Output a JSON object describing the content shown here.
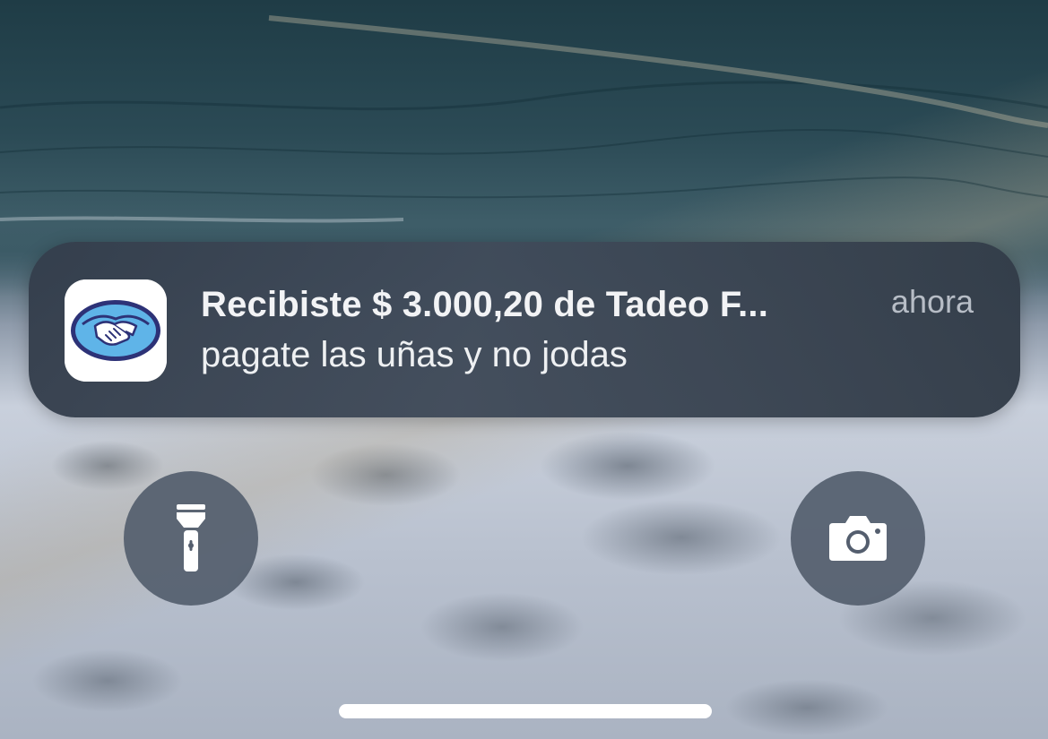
{
  "lock_screen": {
    "notification": {
      "app_icon": "mercado-pago-handshake-icon",
      "title": "Recibiste $ 3.000,20 de Tadeo F...",
      "time": "ahora",
      "body": "pagate las uñas y no jodas"
    },
    "quick_actions": {
      "flashlight_icon": "flashlight-icon",
      "camera_icon": "camera-icon"
    },
    "colors": {
      "notification_bg": "#3c4654",
      "app_icon_blue": "#2d3277",
      "app_icon_light_blue": "#5fb4e8",
      "quick_action_bg": "#545e6e",
      "home_indicator": "#ffffff"
    }
  }
}
